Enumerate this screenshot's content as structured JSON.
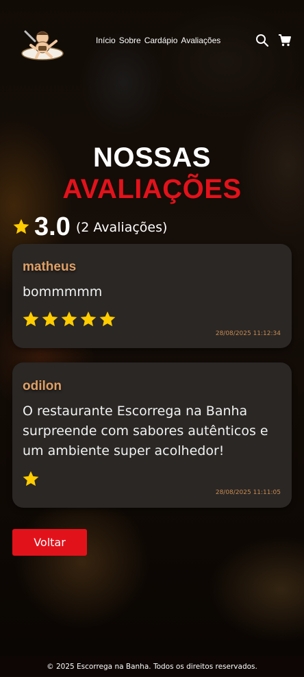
{
  "header": {
    "logo_icon": "chef-boy-logo-icon",
    "nav": [
      {
        "label": "Início"
      },
      {
        "label": "Sobre"
      },
      {
        "label": "Cardápio"
      },
      {
        "label": "Avaliações"
      }
    ],
    "search_icon": "search-icon",
    "cart_icon": "cart-icon"
  },
  "title": {
    "line1": "NOSSAS",
    "line2": "AVALIAÇÕES"
  },
  "summary": {
    "average": "3.0",
    "count_text": "(2 Avaliações)"
  },
  "reviews": [
    {
      "author": "matheus",
      "text": "bommmmm",
      "rating": 5,
      "date": "28/08/2025 11:12:34"
    },
    {
      "author": "odilon",
      "text": "O restaurante Escorrega na Banha surpreende com sabores autênticos e um ambiente super acolhedor!",
      "rating": 1,
      "date": "28/08/2025 11:11:05"
    }
  ],
  "back_button": {
    "label": "Voltar"
  },
  "footer": {
    "text": "© 2025 Escorrega na Banha. Todos os direitos reservados."
  },
  "colors": {
    "accent_red": "#e2121b",
    "author_orange": "#e0a066",
    "star_yellow": "#ffcc00",
    "card_bg": "#2a2725"
  }
}
